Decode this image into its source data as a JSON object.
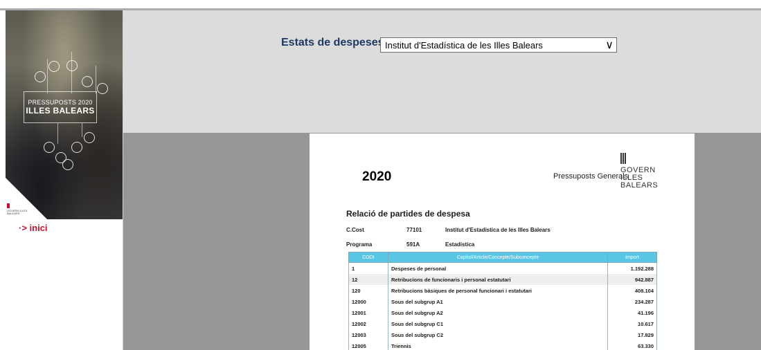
{
  "sidebar": {
    "banner": {
      "line1": "PRESSUPOSTS 2020",
      "line2": "ILLES BALEARS",
      "logo_text": "GOVERN ILLES BALEARS"
    },
    "home_link": "·> inici"
  },
  "header": {
    "label": "Estats de despeses",
    "select_value": "Institut d'Estadística de les Illes Balears"
  },
  "document": {
    "year": "2020",
    "publication": "Pressuposts Generals",
    "logo_lines": [
      "GOVERN",
      "ILLES",
      "BALEARS"
    ],
    "section_title": "Relació de partides de despesa",
    "cost_center": {
      "label": "C.Cost",
      "code": "77101",
      "name": "Institut d'Estadística de les Illes Balears"
    },
    "program": {
      "label": "Programa",
      "code": "591A",
      "name": "Estadística"
    },
    "table": {
      "headers": [
        "CODI",
        "Capítol/Article/Concepte/Subconcepte",
        "Import"
      ],
      "rows": [
        {
          "code": "1",
          "desc": "Despeses de personal",
          "amount": "1.192.288"
        },
        {
          "code": "12",
          "desc": "Retribucions de funcionaris i personal estatutari",
          "amount": "942.887"
        },
        {
          "code": "120",
          "desc": "Retribucions bàsiques de personal funcionari i estatutari",
          "amount": "408.104"
        },
        {
          "code": "12000",
          "desc": "Sous del subgrup A1",
          "amount": "234.287"
        },
        {
          "code": "12001",
          "desc": "Sous del subgrup A2",
          "amount": "41.196"
        },
        {
          "code": "12002",
          "desc": "Sous del subgrup C1",
          "amount": "10.617"
        },
        {
          "code": "12003",
          "desc": "Sous del subgrup C2",
          "amount": "17.829"
        },
        {
          "code": "12005",
          "desc": "Triennis",
          "amount": "63.330"
        }
      ]
    }
  },
  "colors": {
    "accent_red": "#c8102e",
    "header_label": "#1f3864",
    "table_header": "#5bc5e6"
  }
}
